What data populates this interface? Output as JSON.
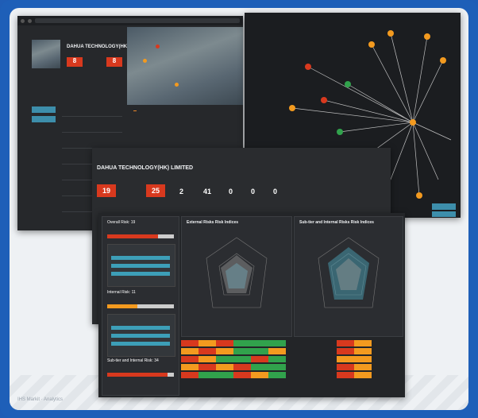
{
  "brand_text": "IHS Markit · Analytics",
  "window1": {
    "url": "",
    "company": "DAHUA TECHNOLOGY(HK) LIMITED",
    "kpi_left": "8",
    "kpi_right": "8",
    "buttons": [
      "",
      ""
    ],
    "details": [
      "",
      "",
      "",
      "",
      "",
      "",
      "",
      "",
      "",
      ""
    ]
  },
  "window2": {
    "buttons": [
      "",
      ""
    ]
  },
  "window3": {
    "breadcrumb": "",
    "company": "DAHUA TECHNOLOGY(HK) LIMITED",
    "kpis": [
      "19",
      "25",
      "2",
      "41",
      "0",
      "0",
      "0"
    ],
    "tabs": [
      "",
      "",
      "",
      ""
    ]
  },
  "window4": {
    "overall_label": "Overall Risk:",
    "overall_value": "19",
    "internal_label": "Internal Risk:",
    "internal_value": "11",
    "subtier_label": "Sub-tier and Internal Risk:",
    "subtier_value": "34",
    "radar1_title": "External Risks Risk Indices",
    "radar2_title": "Sub-tier and Internal Risks Risk Indices",
    "colors": {
      "orange": "#f39a1f",
      "red": "#d8391e",
      "green": "#31a24c",
      "teal": "#3d9fb8"
    }
  }
}
